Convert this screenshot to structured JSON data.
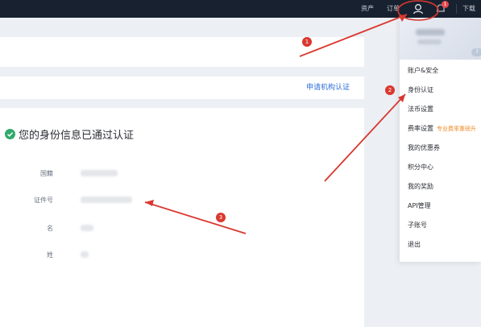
{
  "nav": {
    "assets": "资产",
    "orders": "订单",
    "download": "下载",
    "notification_count": "1"
  },
  "apply_institution": "申请机构认证",
  "verification": {
    "status_text": "您的身份信息已通过认证",
    "rows": [
      {
        "label": "国籍"
      },
      {
        "label": "证件号"
      },
      {
        "label": "名"
      },
      {
        "label": "姓"
      }
    ]
  },
  "dropdown": {
    "level_badge": "7",
    "items": [
      {
        "label": "账户&安全"
      },
      {
        "label": "身份认证"
      },
      {
        "label": "法币设置"
      },
      {
        "label": "费率设置",
        "note": "专业费率重磅升"
      },
      {
        "label": "我的优惠券"
      },
      {
        "label": "积分中心"
      },
      {
        "label": "我的奖励"
      },
      {
        "label": "API管理"
      },
      {
        "label": "子账号"
      },
      {
        "label": "退出"
      }
    ]
  },
  "markers": [
    "1",
    "2",
    "3"
  ],
  "colors": {
    "topbar": "#18212f",
    "annotation_red": "#d9382f",
    "link_blue": "#2f6fd8",
    "success_green": "#2eaa6a",
    "note_orange": "#f08a24"
  }
}
